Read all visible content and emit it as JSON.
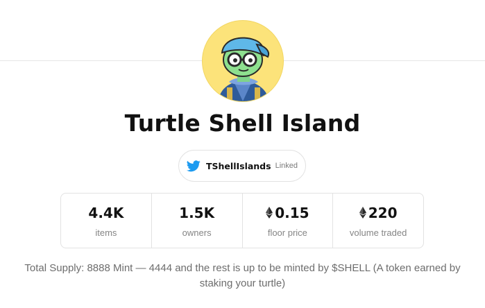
{
  "collection": {
    "title": "Turtle Shell Island",
    "avatar": {
      "icon": "turtle-avatar",
      "bg_color": "#fce37a"
    }
  },
  "twitter": {
    "icon": "twitter-bird-icon",
    "handle": "TShellIslands",
    "status": "Linked",
    "brand_color": "#1d9bf0"
  },
  "stats": [
    {
      "value": "4.4K",
      "label": "items",
      "eth": false
    },
    {
      "value": "1.5K",
      "label": "owners",
      "eth": false
    },
    {
      "value": "0.15",
      "label": "floor price",
      "eth": true
    },
    {
      "value": "220",
      "label": "volume traded",
      "eth": true
    }
  ],
  "description": "Total Supply: 8888 Mint — 4444 and the rest is up to be minted by $SHELL (A token earned by staking your turtle)"
}
